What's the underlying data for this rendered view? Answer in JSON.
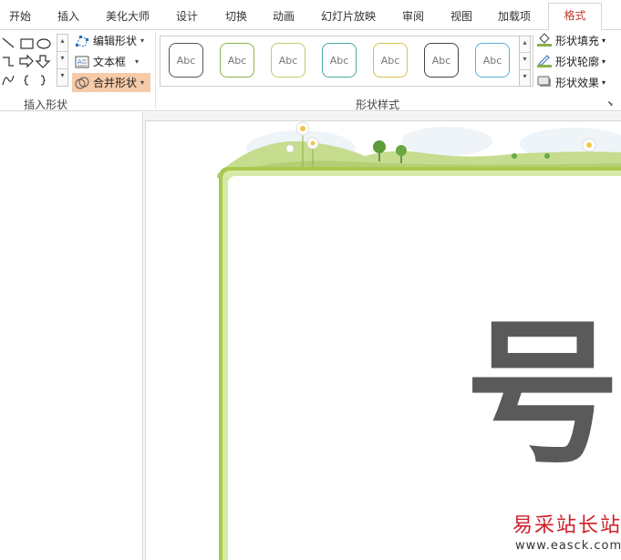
{
  "tabs": [
    "开始",
    "插入",
    "美化大师",
    "设计",
    "切换",
    "动画",
    "幻灯片放映",
    "审阅",
    "视图",
    "加载项",
    "格式"
  ],
  "active_tab": "格式",
  "ribbon": {
    "insert_shapes": {
      "group_label": "插入形状",
      "edit_shape": "编辑形状",
      "text_box": "文本框",
      "merge_shapes": "合并形状"
    },
    "shape_styles": {
      "group_label": "形状样式",
      "swatch_text": "Abc",
      "swatch_colors": [
        "#555555",
        "#8ab24a",
        "#b9d06e",
        "#4aa8a0",
        "#d8c24a",
        "#444444",
        "#5aaed8"
      ],
      "fill": "形状填充",
      "outline": "形状轮廓",
      "effects": "形状效果"
    }
  },
  "slide": {
    "glyph": "号"
  },
  "watermark": {
    "site_name": "易采站长站",
    "url": "www.easck.com"
  }
}
